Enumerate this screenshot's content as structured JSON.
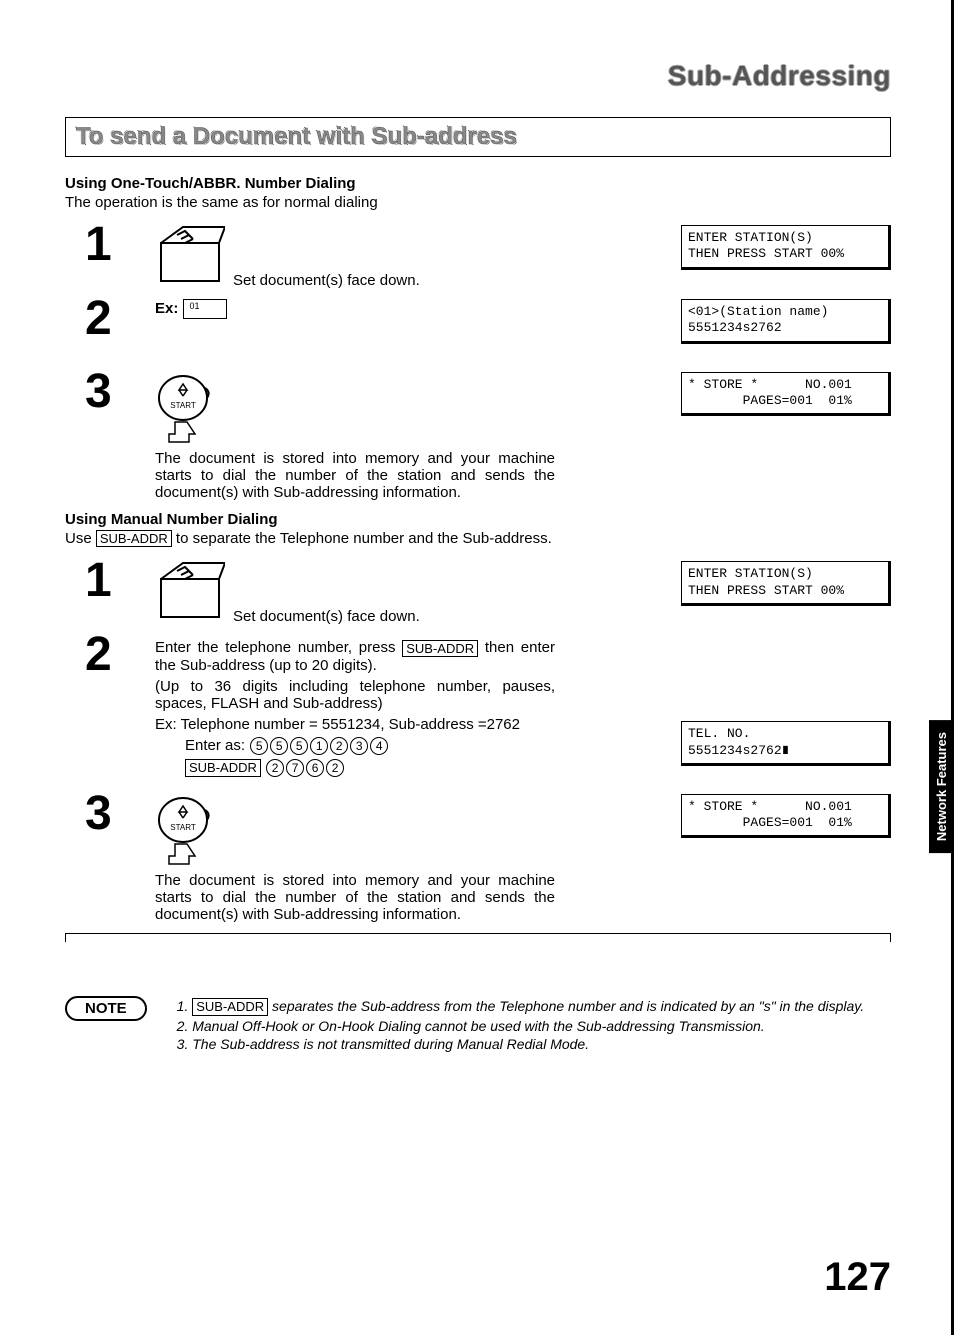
{
  "page_title": "Sub-Addressing",
  "section_title": "To send a Document with Sub-address",
  "side_tab": "Network Features",
  "page_number": "127",
  "sectionA": {
    "heading": "Using One-Touch/ABBR. Number Dialing",
    "desc": "The operation is the same as for normal dialing",
    "step1": {
      "num": "1",
      "text": "Set document(s) face down.",
      "lcd": "ENTER STATION(S)\nTHEN PRESS START 00%"
    },
    "step2": {
      "num": "2",
      "ex_label": "Ex:",
      "ex_key": "01",
      "lcd": "<01>(Station name)\n5551234s2762"
    },
    "step3": {
      "num": "3",
      "start_label": "START",
      "text": "The document is stored into memory and your machine starts to dial the number of the station and sends the document(s) with Sub-addressing information.",
      "lcd": "* STORE *      NO.001\n       PAGES=001  01%"
    }
  },
  "sectionB": {
    "heading": "Using Manual Number Dialing",
    "desc_pre": "Use ",
    "desc_key": "SUB-ADDR",
    "desc_post": " to separate the Telephone number and the Sub-address.",
    "step1": {
      "num": "1",
      "text": "Set document(s) face down.",
      "lcd": "ENTER STATION(S)\nTHEN PRESS START 00%"
    },
    "step2": {
      "num": "2",
      "line1_pre": "Enter the telephone number, press ",
      "line1_key": "SUB-ADDR",
      "line1_post": " then enter the Sub-address (up to 20 digits).",
      "line2": "(Up to 36 digits including telephone number, pauses, spaces, FLASH and Sub-address)",
      "ex_line": "Ex: Telephone number = 5551234, Sub-address =2762",
      "enter_as": "Enter as:",
      "digits_row1": [
        "5",
        "5",
        "5",
        "1",
        "2",
        "3",
        "4"
      ],
      "row2_key": "SUB-ADDR",
      "digits_row2": [
        "2",
        "7",
        "6",
        "2"
      ],
      "lcd": "TEL. NO.\n5551234s2762∎"
    },
    "step3": {
      "num": "3",
      "start_label": "START",
      "text": "The document is stored into memory and your machine starts to dial the number of the station and sends the document(s) with Sub-addressing information.",
      "lcd": "* STORE *      NO.001\n       PAGES=001  01%"
    }
  },
  "note": {
    "label": "NOTE",
    "n1_pre": "1. ",
    "n1_key": "SUB-ADDR",
    "n1_post": " separates the Sub-address from the Telephone number and is indicated by an \"s\" in the display.",
    "n2": "2. Manual Off-Hook or On-Hook Dialing cannot be used with the Sub-addressing Transmission.",
    "n3": "3. The Sub-address is not transmitted during Manual Redial Mode."
  }
}
